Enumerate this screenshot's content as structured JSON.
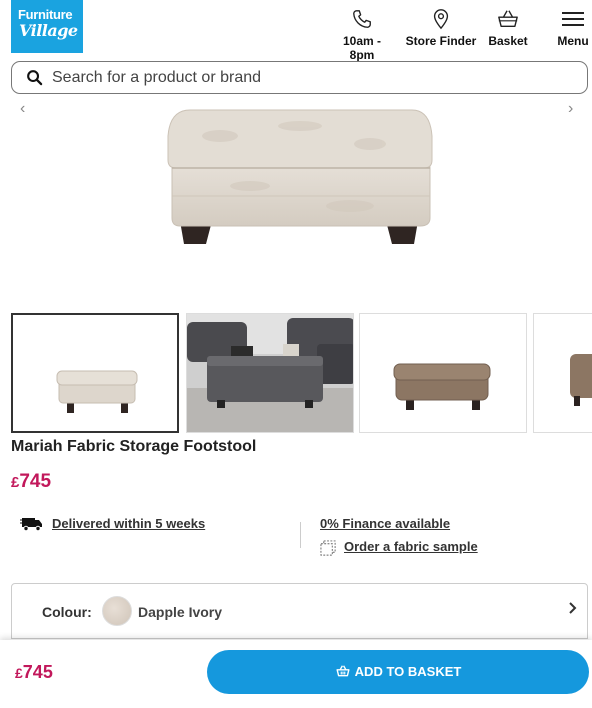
{
  "header": {
    "logo_line1": "Furniture",
    "logo_line2": "Village",
    "nav": [
      {
        "label": "10am - 8pm",
        "icon": "phone-icon"
      },
      {
        "label": "Store Finder",
        "icon": "location-pin-icon"
      },
      {
        "label": "Basket",
        "icon": "basket-icon"
      },
      {
        "label": "Menu",
        "icon": "hamburger-icon"
      }
    ]
  },
  "search": {
    "placeholder": "Search for a product or brand",
    "value": ""
  },
  "gallery": {
    "prev_label": "‹",
    "next_label": "›"
  },
  "product": {
    "title": "Mariah Fabric Storage Footstool",
    "currency": "£",
    "price": "745"
  },
  "info": {
    "delivery": "Delivered within 5 weeks",
    "finance": "0% Finance available",
    "sample": "Order a fabric sample"
  },
  "colour": {
    "label": "Colour:",
    "value": "Dapple Ivory",
    "swatch_color": "#ddd3c8"
  },
  "bottom_bar": {
    "currency": "£",
    "price": "745",
    "button_label": "ADD TO BASKET"
  },
  "colors": {
    "brand_blue": "#1aa3e0",
    "button_blue": "#1598dd",
    "price_pink": "#c2185b"
  }
}
